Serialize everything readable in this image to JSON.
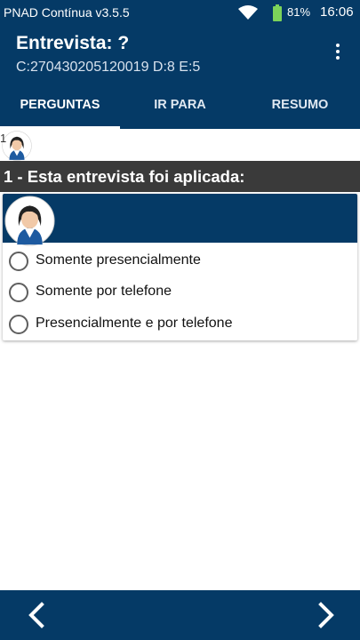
{
  "status_bar": {
    "app_version": "PNAD Contínua v3.5.5",
    "battery_percent": "81%",
    "time": "16:06",
    "icons": [
      "wifi-icon",
      "battery-icon"
    ]
  },
  "app_bar": {
    "title": "Entrevista: ?",
    "subtitle": "C:270430205120019 D:8 E:5",
    "menu_icon": "more-vert-icon"
  },
  "tabs": [
    {
      "label": "PERGUNTAS",
      "active": true
    },
    {
      "label": "IR PARA",
      "active": false
    },
    {
      "label": "RESUMO",
      "active": false
    }
  ],
  "breadcrumb": {
    "number": "1"
  },
  "question": {
    "text": "1 - Esta entrevista foi aplicada:",
    "options": [
      {
        "label": "Somente presencialmente",
        "selected": false
      },
      {
        "label": "Somente por telefone",
        "selected": false
      },
      {
        "label": "Presencialmente e por telefone",
        "selected": false
      }
    ]
  },
  "bottom_nav": {
    "prev_icon": "chevron-left-icon",
    "next_icon": "chevron-right-icon"
  },
  "colors": {
    "primary": "#053a66",
    "question_bar": "#3a3a3a",
    "battery": "#7cd35a"
  }
}
